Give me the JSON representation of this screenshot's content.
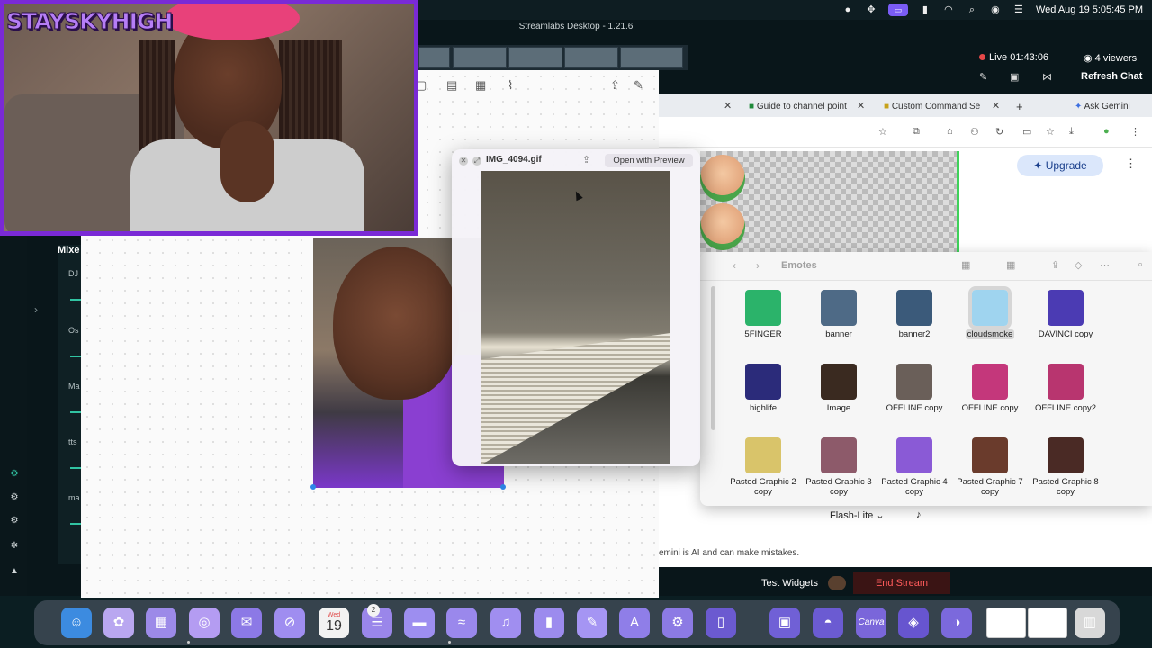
{
  "menubar": {
    "datetime": "Wed Aug 19  5:05:45 PM",
    "status_icons": [
      "obs-icon",
      "drag-icon",
      "screen-record-icon",
      "battery-icon",
      "wifi-icon",
      "search-icon",
      "user-icon",
      "control-center-icon"
    ]
  },
  "streamlabs": {
    "window_title": "Streamlabs Desktop - 1.21.6",
    "live_status": "Live 01:43:06",
    "viewers": "4 viewers",
    "refresh_chat": "Refresh Chat",
    "mixer_title": "Mixe",
    "mixer_channels": [
      "DJ",
      "Os",
      "Ma",
      "tts",
      "ma"
    ],
    "test_widgets": "Test Widgets",
    "end_stream": "End Stream"
  },
  "webcam": {
    "channel_logo": "STAYSKYHIGH"
  },
  "quicklook": {
    "filename": "IMG_4094.gif",
    "open_button": "Open with Preview"
  },
  "browser": {
    "tabs": [
      {
        "label": "Guide to channel point"
      },
      {
        "label": "Custom Command Se"
      }
    ],
    "ask_gemini": "Ask Gemini",
    "upgrade_button": "Upgrade",
    "model_selector": "Flash-Lite",
    "disclaimer": "emini is AI and can make mistakes."
  },
  "finder": {
    "title": "Emotes",
    "files": [
      {
        "label": "5FINGER",
        "color": "#2bb36a"
      },
      {
        "label": "banner",
        "color": "#4e6a86"
      },
      {
        "label": "banner2",
        "color": "#3b5a7a"
      },
      {
        "label": "cloudsmoke",
        "color": "#9fd4ef",
        "selected": true
      },
      {
        "label": "DAVINCI copy",
        "color": "#4b3bb3"
      },
      {
        "label": "highlife",
        "color": "#2b2b7a"
      },
      {
        "label": "Image",
        "color": "#3a2a20"
      },
      {
        "label": "OFFLINE copy",
        "color": "#6a5f59"
      },
      {
        "label": "OFFLINE copy",
        "color": "#c4377b"
      },
      {
        "label": "OFFLINE copy2",
        "color": "#b8356f"
      },
      {
        "label": "Pasted Graphic 2 copy",
        "color": "#d9c46a"
      },
      {
        "label": "Pasted Graphic 3 copy",
        "color": "#8d5a6a"
      },
      {
        "label": "Pasted Graphic 4 copy",
        "color": "#8a5ad6"
      },
      {
        "label": "Pasted Graphic 7 copy",
        "color": "#6a3b2c"
      },
      {
        "label": "Pasted Graphic 8 copy",
        "color": "#4a2a25"
      }
    ]
  },
  "dock": {
    "calendar_day": "Wed",
    "calendar_date": "19",
    "reminders_badge": "2",
    "apps": [
      {
        "name": "finder-icon",
        "color": "#3c8be0"
      },
      {
        "name": "photos-icon",
        "color": "#b9a7f0"
      },
      {
        "name": "launchpad-icon",
        "color": "#9c8ae8"
      },
      {
        "name": "safari-like-icon",
        "color": "#b49cf2"
      },
      {
        "name": "mail-icon",
        "color": "#8c79e6"
      },
      {
        "name": "safari-icon",
        "color": "#9f8df0"
      },
      {
        "name": "calendar-icon",
        "color": "#a391ef"
      },
      {
        "name": "reminders-icon",
        "color": "#9a86ea"
      },
      {
        "name": "notes-icon",
        "color": "#9d8ef0"
      },
      {
        "name": "freeform-icon",
        "color": "#9a88ec"
      },
      {
        "name": "music-icon",
        "color": "#a08ef0"
      },
      {
        "name": "numbers-icon",
        "color": "#9c8bee"
      },
      {
        "name": "pages-icon",
        "color": "#a595f3"
      },
      {
        "name": "app-store-icon",
        "color": "#8f7ee8"
      },
      {
        "name": "system-settings-icon",
        "color": "#8c7ae4"
      },
      {
        "name": "simulator-icon",
        "color": "#6b5ad0"
      },
      {
        "name": "streamlabs-icon",
        "color": "#7060d6"
      },
      {
        "name": "obs-icon",
        "color": "#6b5bd2"
      },
      {
        "name": "canva-icon",
        "color": "#7a66da"
      },
      {
        "name": "stream-deck-icon",
        "color": "#6755cf"
      },
      {
        "name": "messages-icon",
        "color": "#7b69dc"
      },
      {
        "name": "trash-icon",
        "color": "#d8d8d8"
      }
    ],
    "canva_label": "Canva"
  }
}
